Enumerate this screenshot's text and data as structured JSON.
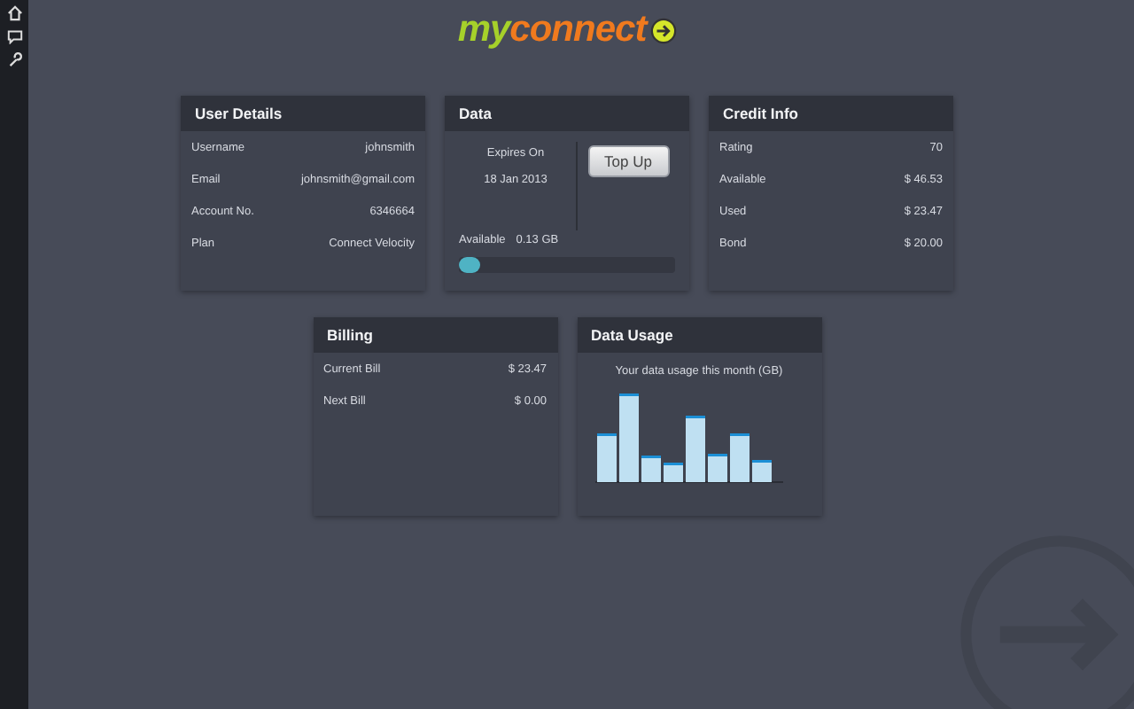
{
  "logo": {
    "part_1": "my",
    "part_2": "connect"
  },
  "user_details": {
    "title": "User Details",
    "rows": [
      {
        "label": "Username",
        "value": "johnsmith"
      },
      {
        "label": "Email",
        "value": "johnsmith@gmail.com"
      },
      {
        "label": "Account No.",
        "value": "6346664"
      },
      {
        "label": "Plan",
        "value": "Connect Velocity"
      }
    ]
  },
  "data": {
    "title": "Data",
    "expires_label": "Expires On",
    "expires_date": "18 Jan 2013",
    "top_up_button": "Top Up",
    "available_label": "Available",
    "available_value": "0.13 GB",
    "usage_bar": {
      "level": 0.04
    }
  },
  "credit_info": {
    "title": "Credit Info",
    "rows": [
      {
        "label": "Rating",
        "value": "70"
      },
      {
        "label": "Available",
        "value": "$ 46.53"
      },
      {
        "label": "Used",
        "value": "$ 23.47"
      },
      {
        "label": "Bond",
        "value": "$ 20.00"
      }
    ]
  },
  "billing": {
    "title": "Billing",
    "rows": [
      {
        "label": "Current Bill",
        "value": "$ 23.47"
      },
      {
        "label": "Next Bill",
        "value": "$ 0.00"
      }
    ]
  },
  "data_usage": {
    "title": "Data Usage",
    "chart_title": "Your data usage this month (GB)"
  }
}
